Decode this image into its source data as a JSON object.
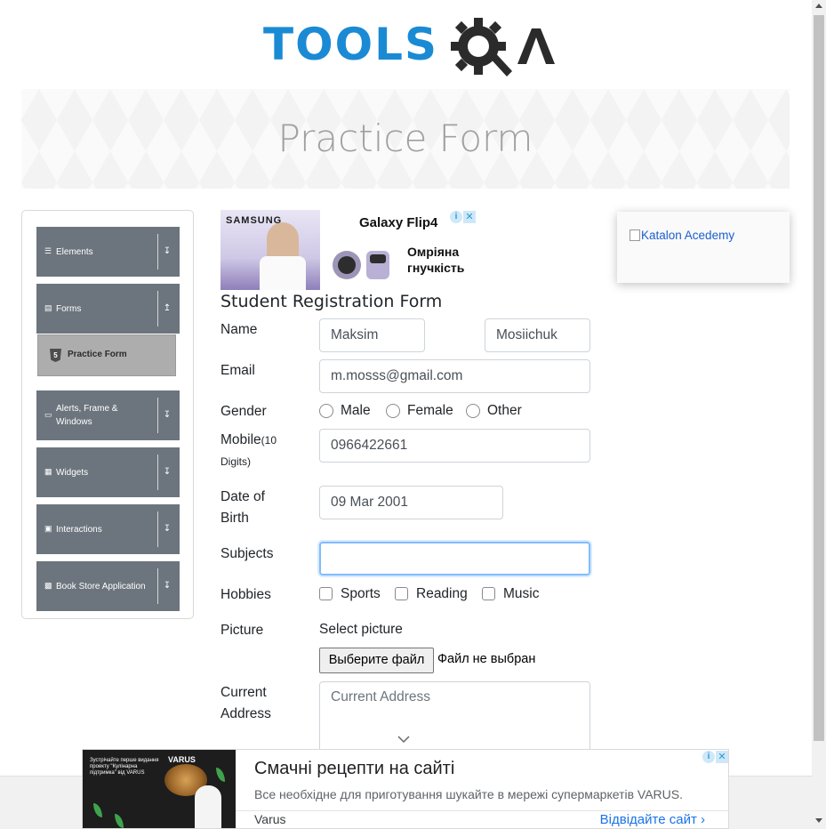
{
  "logo": {
    "text_tools": "TOOLS",
    "text_a": "A"
  },
  "banner": {
    "title": "Practice Form"
  },
  "sidebar": {
    "groups": [
      {
        "label": "Elements",
        "icon": "menu-icon"
      },
      {
        "label": "Forms",
        "icon": "document-icon"
      },
      {
        "label": "Alerts, Frame & Windows",
        "icon": "window-icon"
      },
      {
        "label": "Widgets",
        "icon": "grid-icon"
      },
      {
        "label": "Interactions",
        "icon": "interactions-icon"
      },
      {
        "label": "Book Store Application",
        "icon": "chart-icon"
      }
    ],
    "active_item": {
      "label": "Practice Form",
      "icon_text": "5"
    }
  },
  "ad_top": {
    "brand": "SAMSUNG",
    "product": "Galaxy Flip4",
    "tagline": "Омріяна гнучкість"
  },
  "form": {
    "title": "Student Registration Form",
    "name_label": "Name",
    "first_name": "Maksim",
    "last_name": "Mosiichuk",
    "email_label": "Email",
    "email": "m.mosss@gmail.com",
    "gender_label": "Gender",
    "gender_options": [
      "Male",
      "Female",
      "Other"
    ],
    "mobile_label": "Mobile",
    "mobile_hint": "(10 Digits)",
    "mobile": "0966422661",
    "dob_label_1": "Date of",
    "dob_label_2": "Birth",
    "dob": "09 Mar 2001",
    "subjects_label": "Subjects",
    "subjects": "",
    "hobbies_label": "Hobbies",
    "hobby_options": [
      "Sports",
      "Reading",
      "Music"
    ],
    "picture_label": "Picture",
    "select_picture": "Select picture",
    "file_button": "Выберите файл",
    "file_status": "Файл не выбран",
    "address_label_1": "Current",
    "address_label_2": "Address",
    "address_placeholder": "Current Address"
  },
  "right_ad": {
    "alt": "Katalon Acedemy"
  },
  "bottom_ad": {
    "promo_text": "Зустрічайте перше видання проекту \"Кулінарна підтримка\" від VARUS",
    "brand": "VARUS",
    "headline": "Смачні рецепти на сайті",
    "description": "Все необхідне для приготування шукайте в мережі супермаркетів VARUS.",
    "advertiser": "Varus",
    "cta": "Відвідайте сайт"
  },
  "colors": {
    "logo_blue": "#1a8ad4",
    "sidebar_group": "#6c757d",
    "active_item": "#adadad",
    "focus_border": "#80bdff"
  }
}
